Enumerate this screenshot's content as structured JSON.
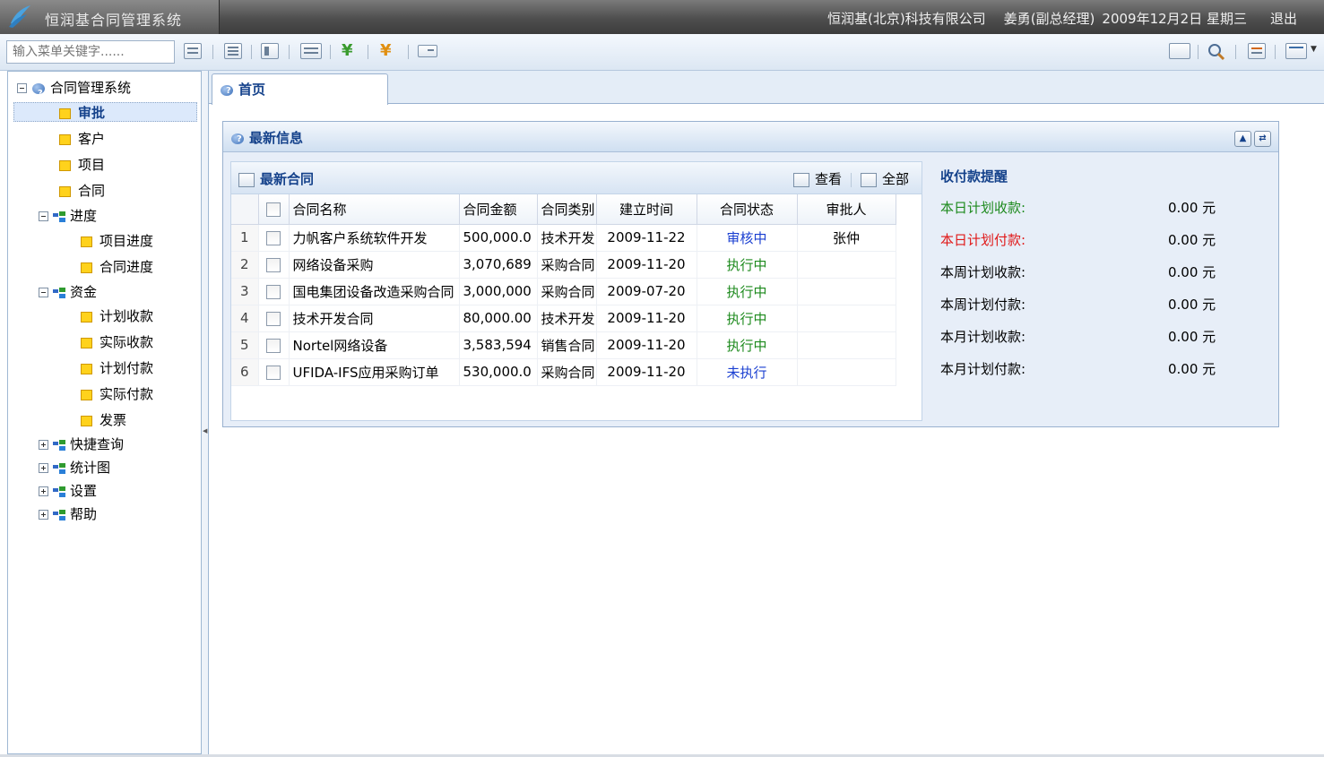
{
  "header": {
    "app_title": "恒润基合同管理系统",
    "company": "恒润基(北京)科技有限公司",
    "user": "姜勇(副总经理)",
    "date": "2009年12月2日 星期三",
    "logout": "退出"
  },
  "toolbar": {
    "search_placeholder": "输入菜单关键字......",
    "yen1": "¥",
    "yen2": "¥"
  },
  "tree": {
    "root": "合同管理系统",
    "approve": "审批",
    "customer": "客户",
    "project": "项目",
    "contract": "合同",
    "progress": "进度",
    "project_progress": "项目进度",
    "contract_progress": "合同进度",
    "funds": "资金",
    "plan_receive": "计划收款",
    "actual_receive": "实际收款",
    "plan_pay": "计划付款",
    "actual_pay": "实际付款",
    "invoice": "发票",
    "quick_query": "快捷查询",
    "stats": "统计图",
    "settings": "设置",
    "help": "帮助"
  },
  "tab": {
    "home": "首页"
  },
  "panel": {
    "title": "最新信息"
  },
  "grid": {
    "title": "最新合同",
    "view": "查看",
    "all": "全部",
    "columns": [
      "合同名称",
      "合同金额",
      "合同类别",
      "建立时间",
      "合同状态",
      "审批人"
    ],
    "rows": [
      {
        "n": "1",
        "name": "力帆客户系统软件开发",
        "amount": "500,000.0",
        "type": "技术开发",
        "date": "2009-11-22",
        "status": "审核中",
        "approver": "张仲"
      },
      {
        "n": "2",
        "name": "网络设备采购",
        "amount": "3,070,689",
        "type": "采购合同",
        "date": "2009-11-20",
        "status": "执行中",
        "approver": ""
      },
      {
        "n": "3",
        "name": "国电集团设备改造采购合同",
        "amount": "3,000,000",
        "type": "采购合同",
        "date": "2009-07-20",
        "status": "执行中",
        "approver": ""
      },
      {
        "n": "4",
        "name": "技术开发合同",
        "amount": "80,000.00",
        "type": "技术开发",
        "date": "2009-11-20",
        "status": "执行中",
        "approver": ""
      },
      {
        "n": "5",
        "name": "Nortel网络设备",
        "amount": "3,583,594",
        "type": "销售合同",
        "date": "2009-11-20",
        "status": "执行中",
        "approver": ""
      },
      {
        "n": "6",
        "name": "UFIDA-IFS应用采购订单",
        "amount": "530,000.0",
        "type": "采购合同",
        "date": "2009-11-20",
        "status": "未执行",
        "approver": ""
      }
    ]
  },
  "colors": {
    "pending": "#1a3fd1",
    "running": "#1d8a1d",
    "not_started": "#1a3fd1",
    "green_label": "#1d8a1d",
    "red_label": "#e01818"
  },
  "reminder": {
    "title": "收付款提醒",
    "items": [
      {
        "label": "本日计划收款:",
        "amount": "0.00 元"
      },
      {
        "label": "本日计划付款:",
        "amount": "0.00 元"
      },
      {
        "label": "本周计划收款:",
        "amount": "0.00 元"
      },
      {
        "label": "本周计划付款:",
        "amount": "0.00 元"
      },
      {
        "label": "本月计划收款:",
        "amount": "0.00 元"
      },
      {
        "label": "本月计划付款:",
        "amount": "0.00 元"
      }
    ]
  }
}
